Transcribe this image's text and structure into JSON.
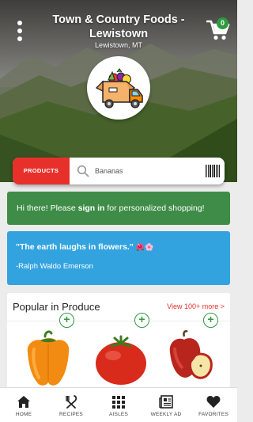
{
  "header": {
    "store_name": "Town & Country Foods - Lewistown",
    "store_location": "Lewistown, MT",
    "cart_count": "0",
    "menu_icon": "kebab-menu-icon",
    "cart_icon": "shopping-cart-icon"
  },
  "search": {
    "tab_label": "PRODUCTS",
    "placeholder": "Bananas",
    "search_icon": "search-icon",
    "barcode_icon": "barcode-scan-icon"
  },
  "signin_banner": {
    "prefix": "Hi there! Please ",
    "link": "sign in",
    "suffix": " for personalized shopping!",
    "color": "#3e8c47"
  },
  "quote": {
    "text": "\"The earth laughs in flowers.\"",
    "flowers": "🌺🌸",
    "author": "-Ralph Waldo Emerson",
    "color": "#33a3e0"
  },
  "produce": {
    "title": "Popular in Produce",
    "view_more": "View 100+ more >",
    "items": [
      {
        "name": "orange-bell-pepper"
      },
      {
        "name": "tomato"
      },
      {
        "name": "red-apple"
      }
    ],
    "add_label": "+"
  },
  "nav": {
    "items": [
      {
        "label": "HOME",
        "icon": "home-icon"
      },
      {
        "label": "RECIPES",
        "icon": "utensils-icon"
      },
      {
        "label": "AISLES",
        "icon": "grid-icon"
      },
      {
        "label": "WEEKLY AD",
        "icon": "newspaper-icon"
      },
      {
        "label": "FAVORITES",
        "icon": "heart-icon"
      }
    ]
  },
  "colors": {
    "accent_red": "#e8302b",
    "accent_green": "#2e9a3f"
  }
}
